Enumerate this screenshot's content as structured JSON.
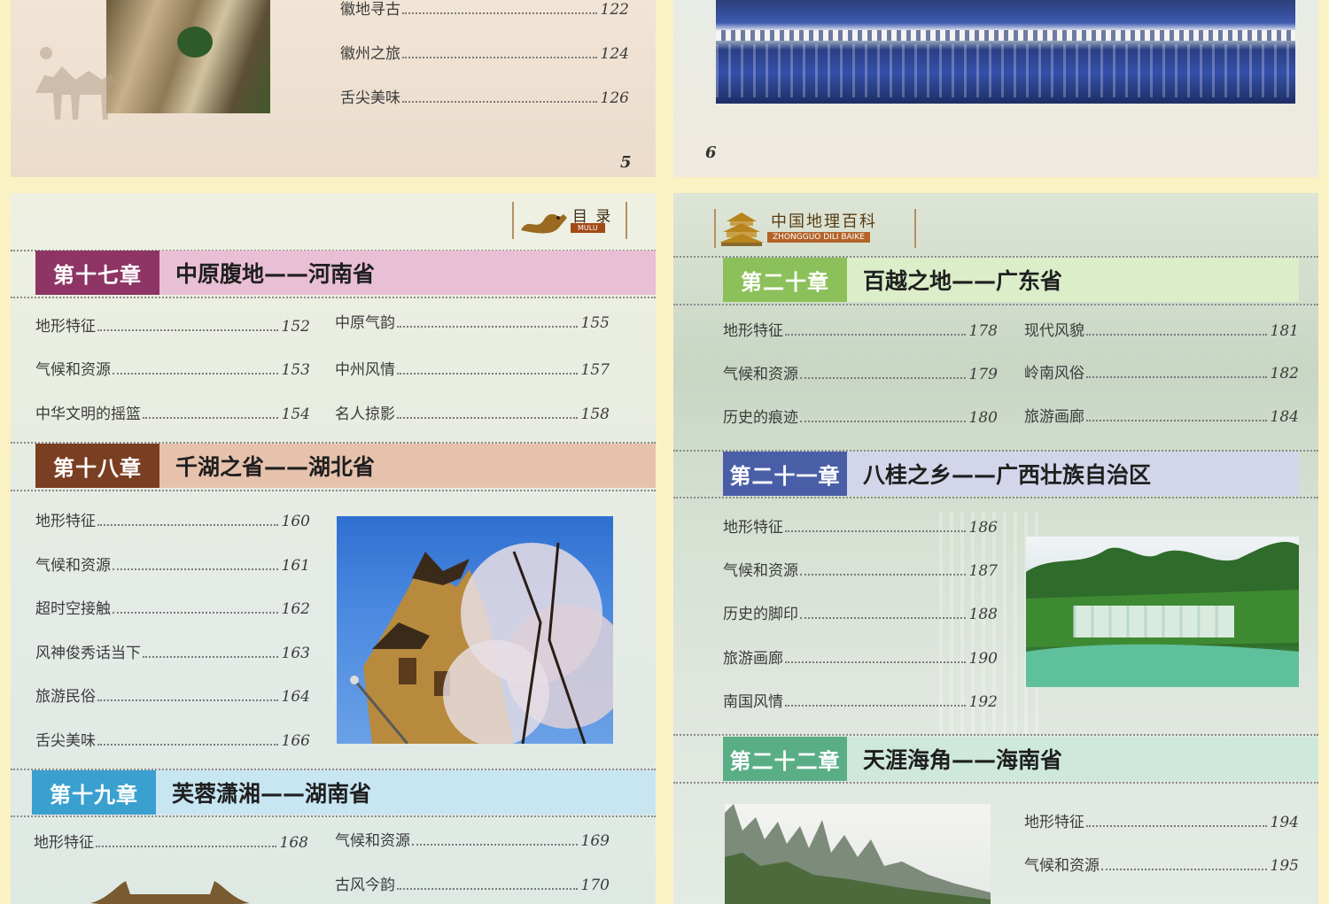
{
  "page_top_left": {
    "entries": [
      {
        "label": "徽地寻古",
        "page": "122"
      },
      {
        "label": "徽州之旅",
        "page": "124"
      },
      {
        "label": "舌尖美味",
        "page": "126"
      }
    ],
    "page_number": "5"
  },
  "page_top_right": {
    "page_number": "6"
  },
  "page_left": {
    "header": {
      "title": "目 录",
      "subtitle": "MULU"
    },
    "chapters": [
      {
        "badge": "第十七章",
        "title": "中原腹地——河南省",
        "color": "#8e3565",
        "band": "#e8bfd4",
        "entries": [
          {
            "label": "地形特征",
            "page": "152"
          },
          {
            "label": "气候和资源",
            "page": "153"
          },
          {
            "label": "中华文明的摇篮",
            "page": "154"
          },
          {
            "label": "中原气韵",
            "page": "155"
          },
          {
            "label": "中州风情",
            "page": "157"
          },
          {
            "label": "名人掠影",
            "page": "158"
          }
        ]
      },
      {
        "badge": "第十八章",
        "title": "千湖之省——湖北省",
        "color": "#7a3e22",
        "band": "#e6c2ad",
        "entries": [
          {
            "label": "地形特征",
            "page": "160"
          },
          {
            "label": "气候和资源",
            "page": "161"
          },
          {
            "label": "超时空接触",
            "page": "162"
          },
          {
            "label": "风神俊秀话当下",
            "page": "163"
          },
          {
            "label": "旅游民俗",
            "page": "164"
          },
          {
            "label": "舌尖美味",
            "page": "166"
          }
        ]
      },
      {
        "badge": "第十九章",
        "title": "芙蓉潇湘——湖南省",
        "color": "#3aa0cf",
        "band": "#c7e6f2",
        "entries": [
          {
            "label": "地形特征",
            "page": "168"
          },
          {
            "label": "气候和资源",
            "page": "169"
          },
          {
            "label": "古风今韵",
            "page": "170"
          }
        ]
      }
    ]
  },
  "page_right": {
    "header": {
      "title": "中国地理百科",
      "subtitle": "ZHONGGUO DILI BAIKE"
    },
    "chapters": [
      {
        "badge": "第二十章",
        "title": "百越之地——广东省",
        "color": "#8cc05a",
        "band": "#dbedc9",
        "entries": [
          {
            "label": "地形特征",
            "page": "178"
          },
          {
            "label": "气候和资源",
            "page": "179"
          },
          {
            "label": "历史的痕迹",
            "page": "180"
          },
          {
            "label": "现代风貌",
            "page": "181"
          },
          {
            "label": "岭南风俗",
            "page": "182"
          },
          {
            "label": "旅游画廊",
            "page": "184"
          }
        ]
      },
      {
        "badge": "第二十一章",
        "title": "八桂之乡——广西壮族自治区",
        "color": "#4a5ea8",
        "band": "#d3d6ea",
        "entries": [
          {
            "label": "地形特征",
            "page": "186"
          },
          {
            "label": "气候和资源",
            "page": "187"
          },
          {
            "label": "历史的脚印",
            "page": "188"
          },
          {
            "label": "旅游画廊",
            "page": "190"
          },
          {
            "label": "南国风情",
            "page": "192"
          }
        ]
      },
      {
        "badge": "第二十二章",
        "title": "天涯海角——海南省",
        "color": "#5aae86",
        "band": "#cfe8dc",
        "entries": [
          {
            "label": "地形特征",
            "page": "194"
          },
          {
            "label": "气候和资源",
            "page": "195"
          }
        ]
      }
    ]
  }
}
